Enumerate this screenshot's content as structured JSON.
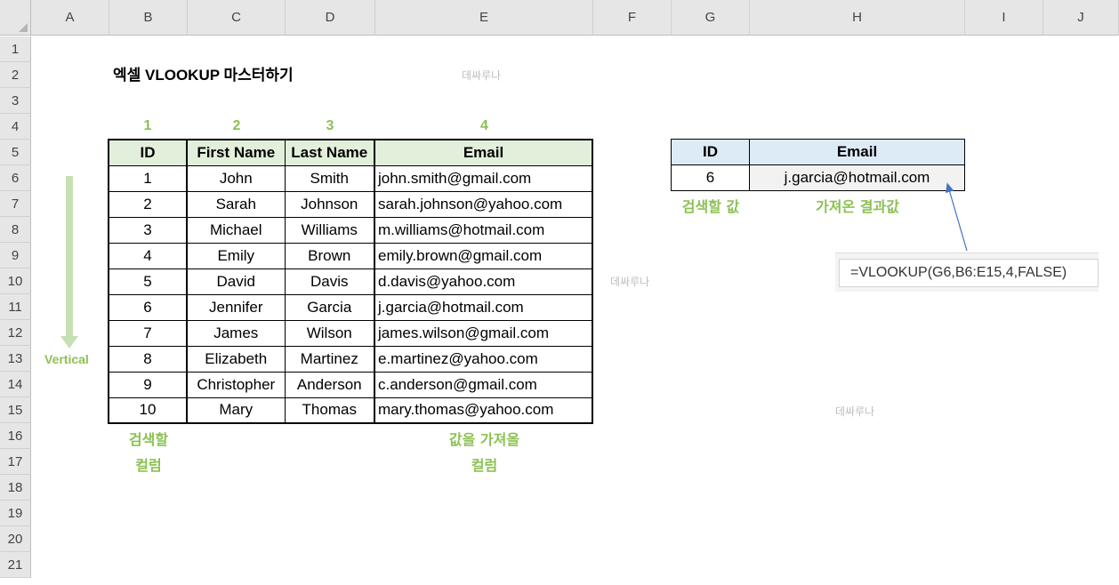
{
  "columns": [
    "A",
    "B",
    "C",
    "D",
    "E",
    "F",
    "G",
    "H",
    "I",
    "J"
  ],
  "rows": [
    "1",
    "2",
    "3",
    "4",
    "5",
    "6",
    "7",
    "8",
    "9",
    "10",
    "11",
    "12",
    "13",
    "14",
    "15",
    "16",
    "17",
    "18",
    "19",
    "20",
    "21"
  ],
  "title": "엑셀 VLOOKUP 마스터하기",
  "watermark": "데싸루나",
  "column_indexes": [
    "1",
    "2",
    "3",
    "4"
  ],
  "table": {
    "headers": [
      "ID",
      "First Name",
      "Last Name",
      "Email"
    ],
    "rows": [
      [
        "1",
        "John",
        "Smith",
        "john.smith@gmail.com"
      ],
      [
        "2",
        "Sarah",
        "Johnson",
        "sarah.johnson@yahoo.com"
      ],
      [
        "3",
        "Michael",
        "Williams",
        "m.williams@hotmail.com"
      ],
      [
        "4",
        "Emily",
        "Brown",
        "emily.brown@gmail.com"
      ],
      [
        "5",
        "David",
        "Davis",
        "d.davis@yahoo.com"
      ],
      [
        "6",
        "Jennifer",
        "Garcia",
        "j.garcia@hotmail.com"
      ],
      [
        "7",
        "James",
        "Wilson",
        "james.wilson@gmail.com"
      ],
      [
        "8",
        "Elizabeth",
        "Martinez",
        "e.martinez@yahoo.com"
      ],
      [
        "9",
        "Christopher",
        "Anderson",
        "c.anderson@gmail.com"
      ],
      [
        "10",
        "Mary",
        "Thomas",
        "mary.thomas@yahoo.com"
      ]
    ]
  },
  "lookup": {
    "headers": [
      "ID",
      "Email"
    ],
    "id_value": "6",
    "result_value": "j.garcia@hotmail.com",
    "search_value_label": "검색할 값",
    "result_label": "가져온 결과값"
  },
  "labels": {
    "vertical": "Vertical",
    "search_column_line1": "검색할",
    "search_column_line2": "컬럼",
    "return_column_line1": "값을 가져올",
    "return_column_line2": "컬럼"
  },
  "formula": "=VLOOKUP(G6,B6:E15,4,FALSE)",
  "colors": {
    "accent_green": "#8cc152",
    "table_header_green": "#e2efda",
    "table_header_blue": "#ddebf7",
    "arrow_blue": "#4472c4"
  }
}
